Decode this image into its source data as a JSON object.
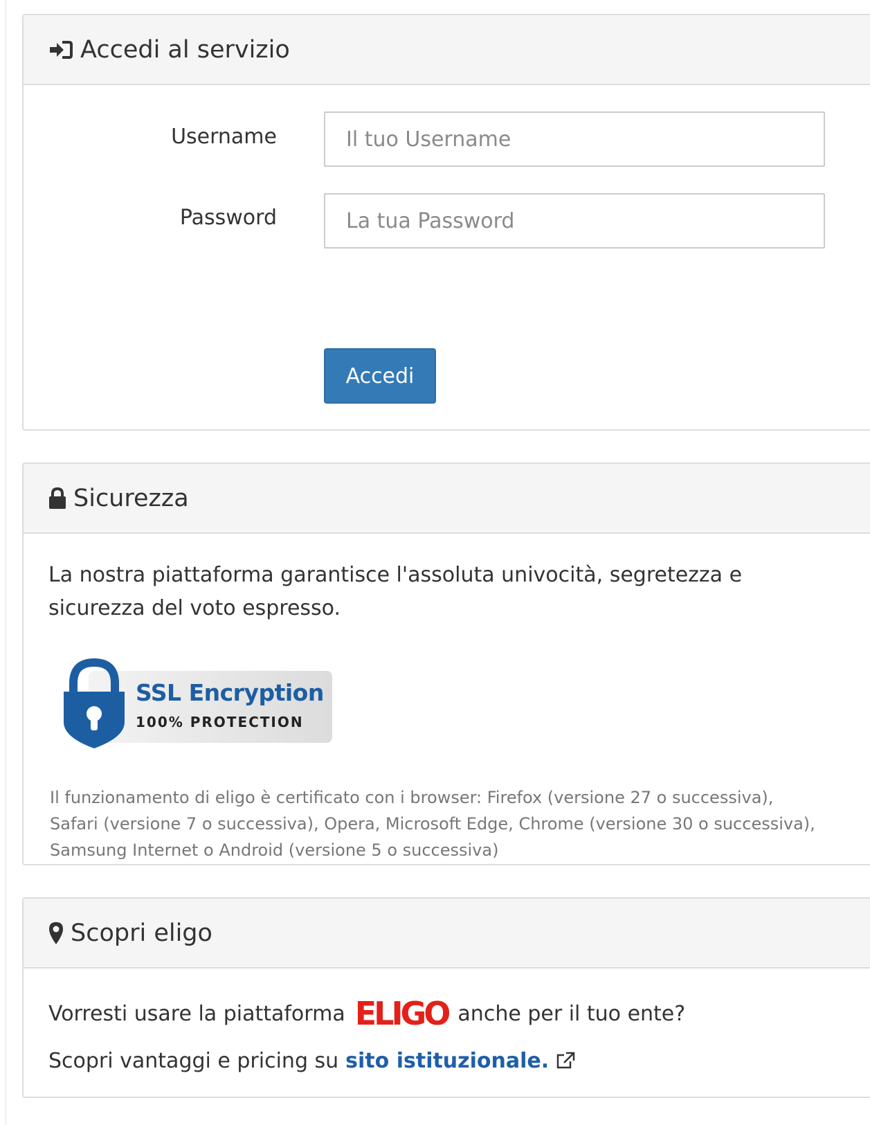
{
  "login": {
    "title": "Accedi al servizio",
    "username_label": "Username",
    "username_placeholder": "Il tuo Username",
    "password_label": "Password",
    "password_placeholder": "La tua Password",
    "submit_label": "Accedi"
  },
  "security": {
    "title": "Sicurezza",
    "description": "La nostra piattaforma garantisce l'assoluta univocità, segretezza e sicurezza del voto espresso.",
    "badge": {
      "title": "SSL Encryption",
      "subtitle": "100% PROTECTION"
    },
    "browser_note": "Il funzionamento di eligo è certificato con i browser: Firefox (versione 27 o successiva), Safari (versione 7 o successiva), Opera, Microsoft Edge, Chrome (versione 30 o successiva), Samsung Internet o Android (versione 5 o successiva)"
  },
  "discover": {
    "title": "Scopri eligo",
    "line1_before": "Vorresti usare la piattaforma",
    "logo_text": "ELIGO",
    "line1_after": "anche per il tuo ente?",
    "line2_before": "Scopri vantaggi e pricing su",
    "link_label": "sito istituzionale."
  },
  "colors": {
    "primary": "#337ab7",
    "link": "#1f5fa8",
    "brand_red": "#e32119",
    "ssl_blue": "#1d5ea3"
  },
  "icons": {
    "login": "sign-in-icon",
    "security": "lock-icon",
    "discover": "map-marker-icon",
    "link": "external-link-icon"
  }
}
